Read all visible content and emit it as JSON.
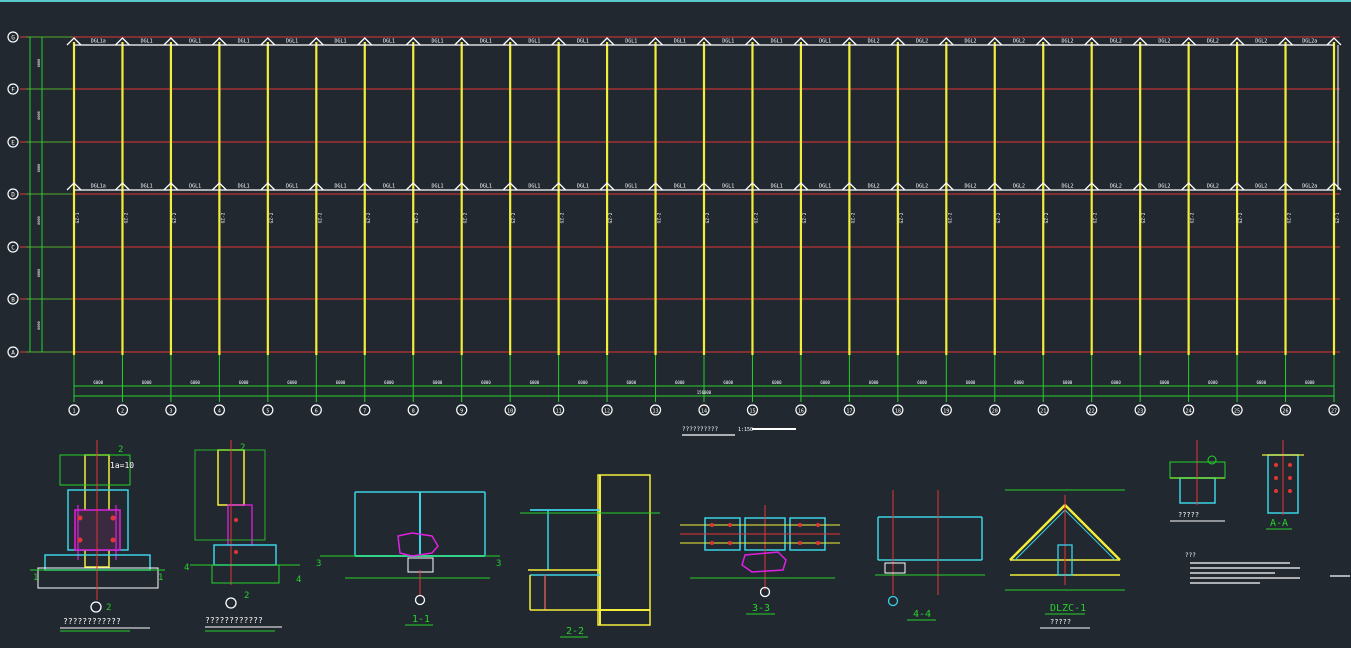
{
  "colors": {
    "background": "#212830",
    "grid": "#e23636",
    "column": "#f2ee3a",
    "beam": "#ffffff",
    "dimension": "#28d228",
    "axis_bubble": "#ffffff",
    "cyan": "#3cd2e6",
    "magenta": "#e020e0",
    "orange": "#c89a28"
  },
  "row_axes": [
    "G",
    "F",
    "E",
    "D",
    "C",
    "B",
    "A"
  ],
  "col_axes": [
    "1",
    "2",
    "3",
    "4",
    "5",
    "6",
    "7",
    "8",
    "9",
    "10",
    "11",
    "12",
    "13",
    "14",
    "15",
    "16",
    "17",
    "18",
    "19",
    "20",
    "21",
    "22",
    "23",
    "24",
    "25",
    "26",
    "27"
  ],
  "top_beams": [
    "DGL1a",
    "DGL1",
    "DGL1",
    "DGL1",
    "DGL1",
    "DGL1",
    "DGL1",
    "DGL1",
    "DGL1",
    "DGL1",
    "DGL1",
    "DGL1",
    "DGL1",
    "DGL1",
    "DGL1",
    "DGL1",
    "DGL2",
    "DGL2",
    "DGL2",
    "DGL2",
    "DGL2",
    "DGL2",
    "DGL2",
    "DGL2",
    "DGL2",
    "DGL2a"
  ],
  "mid_beams": [
    "DGL1a",
    "DGL1",
    "DGL1",
    "DGL1",
    "DGL1",
    "DGL1",
    "DGL1",
    "DGL1",
    "DGL1",
    "DGL1",
    "DGL1",
    "DGL1",
    "DGL1",
    "DGL1",
    "DGL1",
    "DGL1",
    "DGL2",
    "DGL2",
    "DGL2",
    "DGL2",
    "DGL2",
    "DGL2",
    "DGL2",
    "DGL2",
    "DGL2",
    "DGL2a"
  ],
  "column_tags": [
    "GZ-1",
    "GZ-2",
    "GZ-2",
    "GZ-2",
    "GZ-2",
    "GZ-2",
    "GZ-2",
    "GZ-2",
    "GZ-2",
    "GZ-2",
    "GZ-2",
    "GZ-2",
    "GZ-2",
    "GZ-2",
    "GZ-2",
    "GZ-2",
    "GZ-2",
    "GZ-2",
    "GZ-2",
    "GZ-2",
    "GZ-2",
    "GZ-2",
    "GZ-2",
    "GZ-2",
    "GZ-2",
    "GZ-2",
    "GZ-1"
  ],
  "bay_dims": [
    "6000",
    "6000",
    "6000",
    "6000",
    "6000",
    "6000",
    "6000",
    "6000",
    "6000",
    "6000",
    "6000",
    "6000",
    "6000",
    "6000",
    "6000",
    "6000",
    "6000",
    "6000",
    "6000",
    "6000",
    "6000",
    "6000",
    "6000",
    "6000",
    "6000",
    "6000"
  ],
  "total_dim": "156000",
  "left_dims": [
    "6000",
    "6000",
    "6000",
    "6000",
    "6000",
    "6000"
  ],
  "plan_note": "??????????",
  "plan_scale": "1:150",
  "details": {
    "d1_title": "????????????",
    "d1_plate": "1a=10",
    "d2_title": "????????????",
    "sec_1": "1-1",
    "sec_2": "2-2",
    "sec_3": "3-3",
    "sec_4": "4-4",
    "dlzc": "DLZC-1",
    "dlzc_sub": "?????",
    "small_title": "?????",
    "aa": "A-A",
    "notes_head": "???",
    "mark_2": "2",
    "mark_3": "3",
    "mark_4": "4",
    "mark_1": "1"
  }
}
